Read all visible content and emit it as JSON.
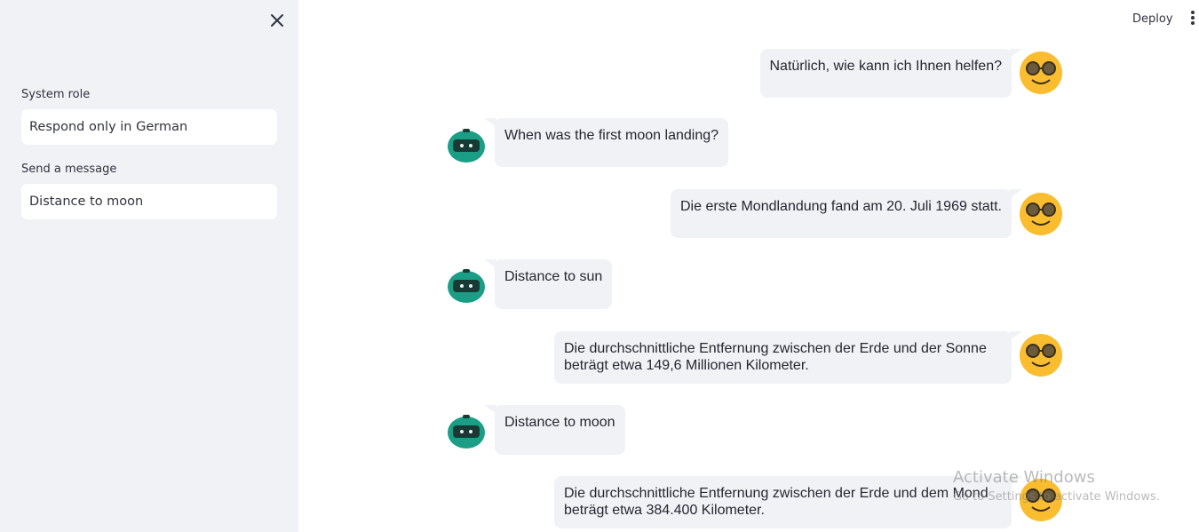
{
  "sidebar": {
    "system_role_label": "System role",
    "system_role_value": "Respond only in German",
    "message_label": "Send a message",
    "message_value": "Distance to moon"
  },
  "header": {
    "deploy_label": "Deploy"
  },
  "messages": [
    {
      "role": "assistant",
      "text": "Natürlich, wie kann ich Ihnen helfen?"
    },
    {
      "role": "user",
      "text": "When was the first moon landing?"
    },
    {
      "role": "assistant",
      "text": "Die erste Mondlandung fand am 20. Juli 1969 statt."
    },
    {
      "role": "user",
      "text": "Distance to sun"
    },
    {
      "role": "assistant",
      "text": "Die durchschnittliche Entfernung zwischen der Erde und der Sonne beträgt etwa 149,6 Millionen Kilometer."
    },
    {
      "role": "user",
      "text": "Distance to moon"
    },
    {
      "role": "assistant",
      "text": "Die durchschnittliche Entfernung zwischen der Erde und dem Mond beträgt etwa 384.400 Kilometer."
    }
  ],
  "watermark": {
    "title": "Activate Windows",
    "subtitle": "Go to Settings to activate Windows."
  },
  "icons": {
    "close": "close-icon",
    "menu": "more-vertical-icon",
    "assistant_avatar": "nerd-face-icon",
    "user_avatar": "robot-icon"
  },
  "colors": {
    "sidebar_bg": "#f0f2f6",
    "bubble_bg": "#f0f2f6",
    "assistant_avatar": "#f9bd2f",
    "user_avatar": "#1a9e86"
  }
}
